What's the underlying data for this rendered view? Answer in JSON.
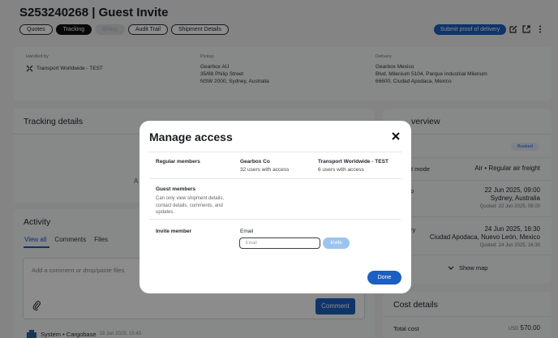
{
  "header": {
    "title": "S253240268 | Guest Invite",
    "tabs": [
      "Quotes",
      "Tracking",
      "Billing",
      "Audit Trail",
      "Shipment Details"
    ],
    "submit_label": "Submit proof of delivery"
  },
  "info": {
    "handled_by_label": "Handled by",
    "handled_by": "Transport Worldwide - TEST",
    "pickup_label": "Pickup",
    "pickup_name": "Gearbox AU",
    "pickup_line1": "35/88 Philip Street",
    "pickup_line2": "NSW 2000, Sydney, Australia",
    "delivery_label": "Delivery",
    "delivery_name": "Gearbox Mexico",
    "delivery_line1": "Blvd. Milenium 5104, Parque Industrial Milenum",
    "delivery_line2": "66600, Ciudad Apodaca, Mexico"
  },
  "tracking": {
    "title": "Tracking details",
    "partial_text": "A"
  },
  "activity": {
    "title": "Activity",
    "tabs": [
      "View all",
      "Comments",
      "Files"
    ],
    "comment_placeholder": "Add a comment or drop/paste files.",
    "comment_button": "Comment",
    "log_author": "System • Cargobase",
    "log_time": "18 Jun 2025, 15:43"
  },
  "overview": {
    "title_visible": "verview",
    "status_badge": "Booked",
    "mode_label_visible": "t mode",
    "mode_value": "Air • Regular air freight",
    "pickup_label_visible": "p",
    "pickup_date": "22 Jun 2025, 09:00",
    "pickup_place": "Sydney, Australia",
    "pickup_quoted": "Quoted: 22 Jun 2025, 09:00",
    "delivery_label_visible": "ry",
    "delivery_date": "24 Jun 2025, 16:30",
    "delivery_place": "Ciudad Apodaca, Nuevo León, Mexico",
    "delivery_quoted": "Quoted: 24 Jun 2025, 16:30",
    "show_map": "Show map"
  },
  "cost": {
    "title": "Cost details",
    "total_label": "Total cost",
    "currency": "USD",
    "total_value": "570.00"
  },
  "modal": {
    "title": "Manage access",
    "regular_label": "Regular members",
    "org1_name": "Gearbox Co",
    "org1_count": "32 users with access",
    "org2_name": "Transport Worldwide - TEST",
    "org2_count": "6 users with access",
    "guest_label": "Guest members",
    "guest_desc": "Can only view shipment details, contact details, comments, and updates.",
    "invite_label": "Invite member",
    "email_label": "Email",
    "email_placeholder": "Email",
    "invite_button": "Invite",
    "done_button": "Done"
  },
  "colors": {
    "accent": "#1a5fc2",
    "invite_disabled": "#9cc4ef"
  }
}
